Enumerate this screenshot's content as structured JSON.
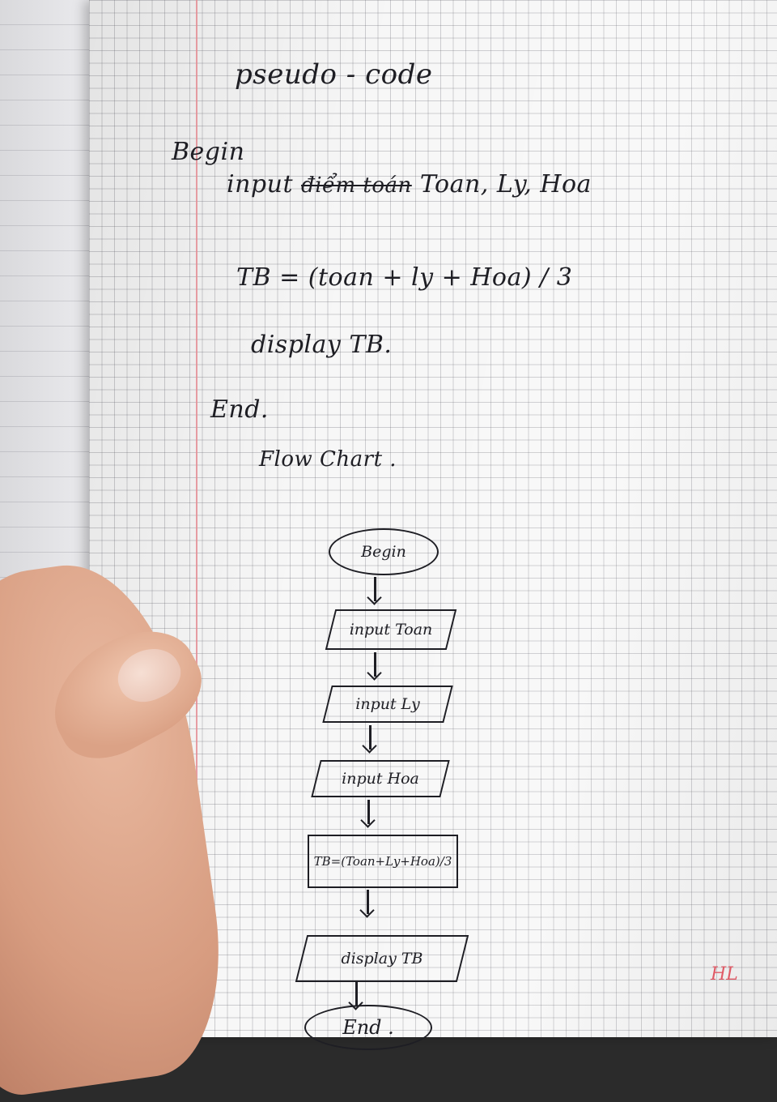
{
  "pseudocode": {
    "title": "pseudo - code",
    "begin": "Begin",
    "input_keyword": "input",
    "crossed_out": "điểm toán",
    "input_vars": "Toan, Ly, Hoa",
    "formula": "TB = (toan + ly + Hoa) / 3",
    "display": "display TB.",
    "end": "End."
  },
  "flowchart": {
    "heading": "Flow Chart .",
    "start": "Begin",
    "steps": [
      {
        "shape": "parallelogram",
        "label": "input Toan"
      },
      {
        "shape": "parallelogram",
        "label": "input Ly"
      },
      {
        "shape": "parallelogram",
        "label": "input Hoa"
      },
      {
        "shape": "rectangle",
        "label": "TB=(Toan+Ly+Hoa)/3"
      },
      {
        "shape": "parallelogram",
        "label": "display TB"
      }
    ],
    "stop": "End ."
  },
  "watermark": "HL",
  "colors": {
    "ink": "#1e1e24",
    "margin_line": "#e48d94",
    "paper": "#f7f7f7",
    "watermark": "#e05a66"
  }
}
